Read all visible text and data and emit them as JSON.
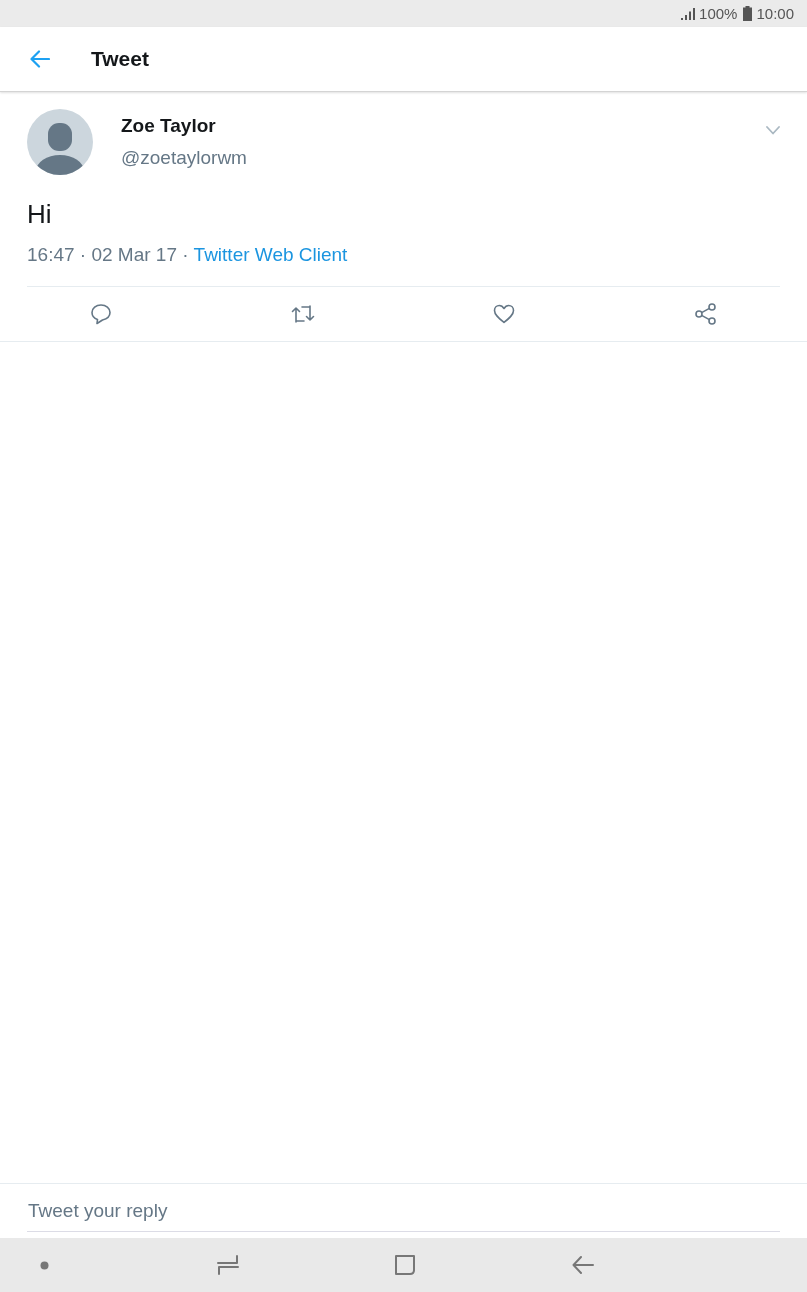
{
  "status_bar": {
    "battery": "100%",
    "time": "10:00"
  },
  "header": {
    "title": "Tweet"
  },
  "tweet": {
    "author": {
      "name": "Zoe Taylor",
      "handle": "@zoetaylorwm"
    },
    "text": "Hi",
    "timestamp": "16:47 · 02 Mar 17 ·",
    "source": "Twitter Web Client"
  },
  "actions": [
    {
      "kind": "reply"
    },
    {
      "kind": "retweet"
    },
    {
      "kind": "like"
    },
    {
      "kind": "share"
    }
  ],
  "reply_box": {
    "placeholder": "Tweet your reply"
  }
}
